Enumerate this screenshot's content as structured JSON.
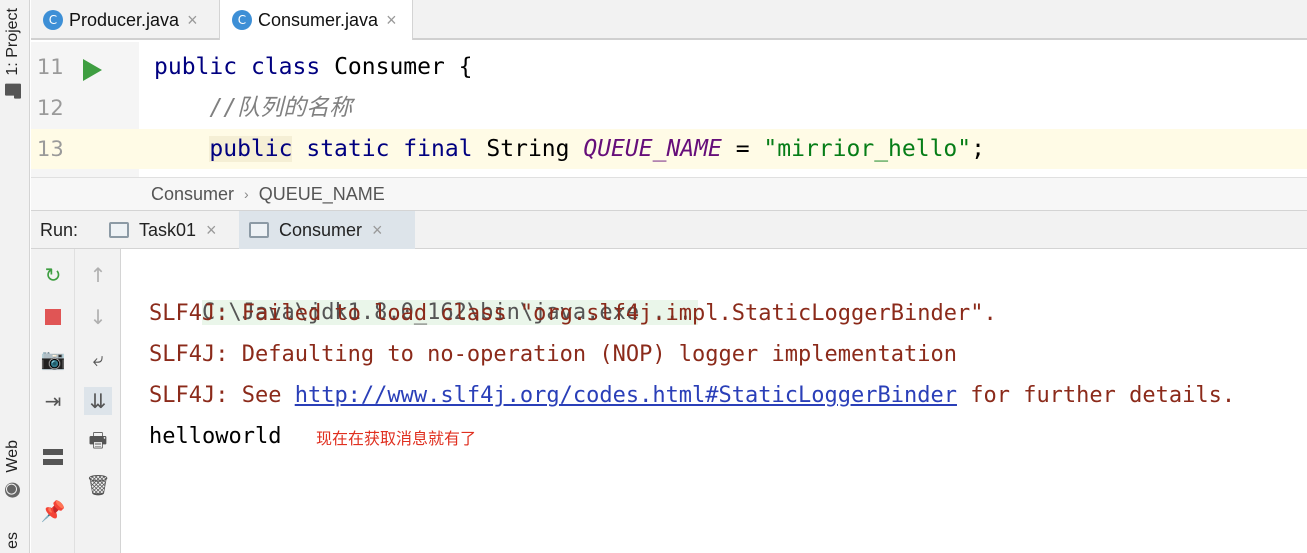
{
  "left_strip": {
    "project_tab": "1: Project",
    "web_tab": "Web",
    "bottom_partial": "es"
  },
  "editor_tabs": [
    {
      "icon": "C",
      "label": "Producer.java",
      "close": "×",
      "active": false
    },
    {
      "icon": "C",
      "label": "Consumer.java",
      "close": "×",
      "active": true
    }
  ],
  "editor": {
    "lines": [
      {
        "number": "11",
        "text": "public class Consumer {"
      },
      {
        "number": "12",
        "text": "//队列的名称"
      },
      {
        "number": "13",
        "text": "public static final String QUEUE_NAME = \"mirrior_hello\";"
      }
    ],
    "tokens": {
      "l11_public": "public",
      "l11_class": "class",
      "l11_name": "Consumer {",
      "l12_comment": "//队列的名称",
      "l13_public": "public",
      "l13_static": "static",
      "l13_final": "final",
      "l13_type": "String",
      "l13_const": "QUEUE_NAME",
      "l13_eq": "=",
      "l13_string": "\"mirrior_hello\"",
      "l13_semi": ";"
    }
  },
  "breadcrumb": {
    "class": "Consumer",
    "field": "QUEUE_NAME"
  },
  "run_panel": {
    "label": "Run:",
    "tabs": [
      {
        "label": "Task01",
        "close": "×",
        "active": false
      },
      {
        "label": "Consumer",
        "close": "×",
        "active": true
      }
    ]
  },
  "toolbar_left": [
    "rerun-icon",
    "stop-icon",
    "camera-icon",
    "exit-icon",
    "layout-icon",
    "pin-icon"
  ],
  "toolbar_right": [
    "up-arrow-icon",
    "down-arrow-icon",
    "soft-wrap-icon",
    "scroll-to-end-icon",
    "print-icon",
    "trash-icon"
  ],
  "console": {
    "cmd": "C:\\Java\\jdk1.8.0_162\\bin\\java.exe ...",
    "slf4j_1": "SLF4J: Failed to load class \"org.slf4j.impl.StaticLoggerBinder\".",
    "slf4j_2": "SLF4J: Defaulting to no-operation (NOP) logger implementation",
    "slf4j_3_prefix": "SLF4J: See ",
    "slf4j_3_link": "http://www.slf4j.org/codes.html#StaticLoggerBinder",
    "slf4j_3_suffix": " for further details.",
    "output": "helloworld",
    "annotation": "现在在获取消息就有了"
  },
  "colors": {
    "keyword": "#000080",
    "constant": "#660e7a",
    "string": "#067d17",
    "comment": "#808080",
    "error_text": "#8b2a1a",
    "link": "#2a3fb8",
    "annotation": "#e03020",
    "run_green": "#3e9e41"
  }
}
